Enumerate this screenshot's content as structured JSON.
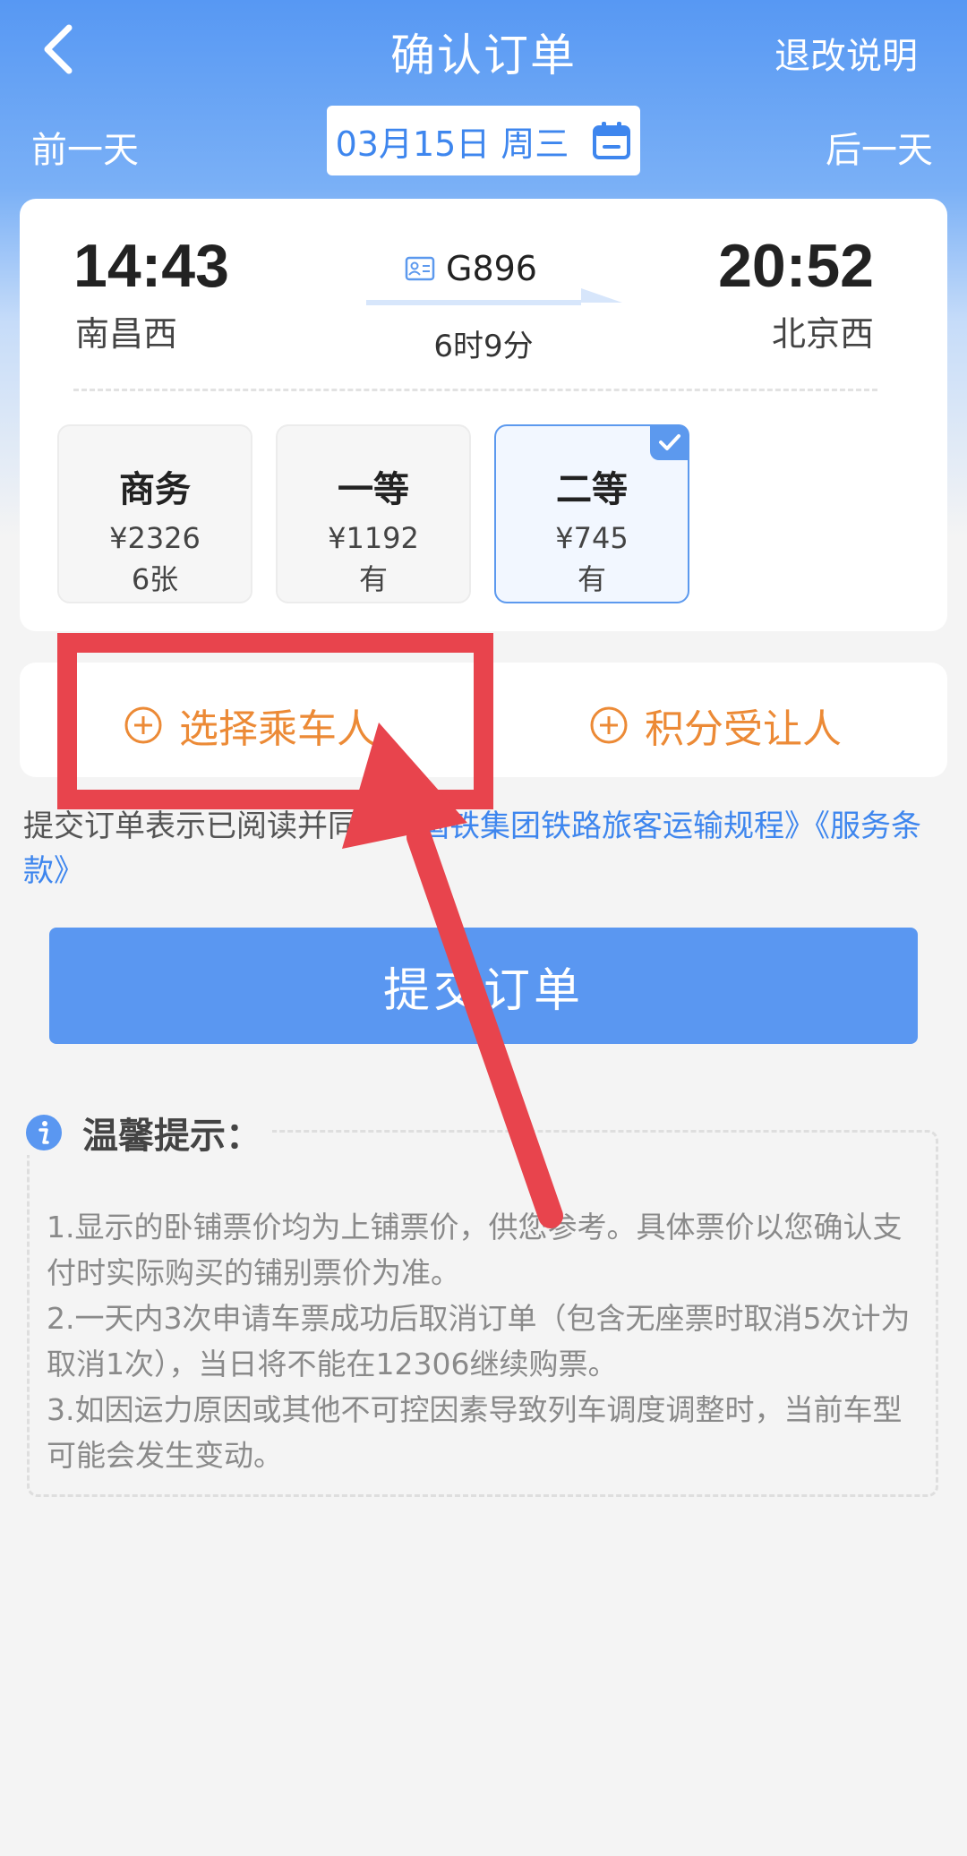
{
  "header": {
    "title": "确认订单",
    "refund_link": "退改说明"
  },
  "date_bar": {
    "prev_day": "前一天",
    "date": "03月15日 周三",
    "next_day": "后一天"
  },
  "train": {
    "number": "G896",
    "departure_time": "14:43",
    "departure_station": "南昌西",
    "arrival_time": "20:52",
    "arrival_station": "北京西",
    "duration": "6时9分"
  },
  "seats": [
    {
      "name": "商务",
      "price": "¥2326",
      "availability": "6张",
      "selected": false
    },
    {
      "name": "一等",
      "price": "¥1192",
      "availability": "有",
      "selected": false
    },
    {
      "name": "二等",
      "price": "¥745",
      "availability": "有",
      "selected": true
    }
  ],
  "passengers": {
    "select_passenger": "选择乘车人",
    "points_transferee": "积分受让人"
  },
  "agreement": {
    "prefix": "提交订单表示已阅读并同意",
    "link1": "《国铁集团铁路旅客运输规程》",
    "link2": "《服务条款》"
  },
  "submit_label": "提交订单",
  "tips": {
    "title": "温馨提示：",
    "items": [
      "1.显示的卧铺票价均为上铺票价，供您参考。具体票价以您确认支付时实际购买的铺别票价为准。",
      "2.一天内3次申请车票成功后取消订单（包含无座票时取消5次计为取消1次），当日将不能在12306继续购票。",
      "3.如因运力原因或其他不可控因素导致列车调度调整时，当前车型可能会发生变动。"
    ]
  },
  "colors": {
    "primary_blue": "#5a97f1",
    "accent_orange": "#ec8a36",
    "annotation_red": "#e8444d"
  }
}
